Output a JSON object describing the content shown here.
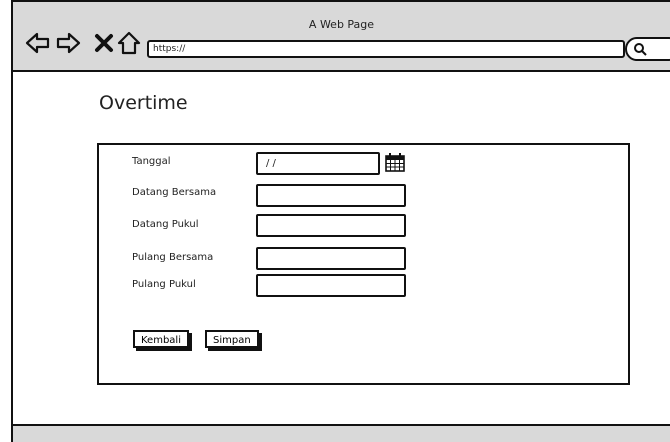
{
  "browser": {
    "window_title": "A Web Page",
    "url": "https://"
  },
  "page": {
    "heading": "Overtime"
  },
  "form": {
    "fields": [
      {
        "label": "Tanggal",
        "value": "/ /"
      },
      {
        "label": "Datang Bersama",
        "value": ""
      },
      {
        "label": "Datang Pukul",
        "value": ""
      },
      {
        "label": "Pulang Bersama",
        "value": ""
      },
      {
        "label": "Pulang Pukul",
        "value": ""
      }
    ],
    "back_label": "Kembali",
    "save_label": "Simpan"
  },
  "icons": [
    "back-arrow-icon",
    "forward-arrow-icon",
    "close-icon",
    "home-icon",
    "search-icon",
    "calendar-icon"
  ]
}
